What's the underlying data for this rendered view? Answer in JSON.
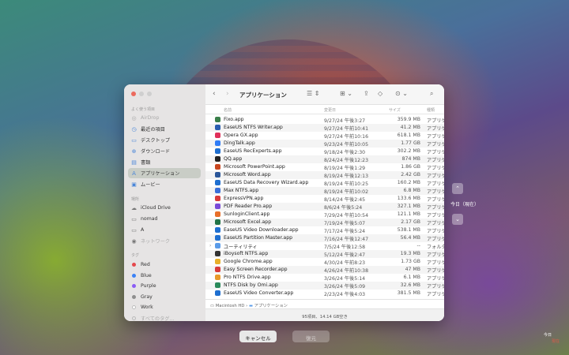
{
  "window": {
    "title": "アプリケーション"
  },
  "sidebar": {
    "favorites_label": "よく使う項目",
    "favorites": [
      {
        "icon": "airdrop-icon",
        "glyph": "◎",
        "label": "AirDrop",
        "dim": true
      },
      {
        "icon": "clock-icon",
        "glyph": "◷",
        "label": "最近の項目"
      },
      {
        "icon": "desktop-icon",
        "glyph": "▭",
        "label": "デスクトップ"
      },
      {
        "icon": "download-icon",
        "glyph": "⊕",
        "label": "ダウンロード"
      },
      {
        "icon": "document-icon",
        "glyph": "▤",
        "label": "書類"
      },
      {
        "icon": "applications-icon",
        "glyph": "A",
        "label": "アプリケーション",
        "selected": true
      },
      {
        "icon": "movie-icon",
        "glyph": "▣",
        "label": "ムービー"
      }
    ],
    "locations_label": "場所",
    "locations": [
      {
        "icon": "cloud-icon",
        "glyph": "☁",
        "label": "iCloud Drive"
      },
      {
        "icon": "drive-icon",
        "glyph": "▭",
        "label": "nomad"
      },
      {
        "icon": "drive-icon",
        "glyph": "▭",
        "label": "A"
      },
      {
        "icon": "network-icon",
        "glyph": "◉",
        "label": "ネットワーク",
        "dim": true
      }
    ],
    "tags_label": "タグ",
    "tags": [
      {
        "label": "Red",
        "color": "#e5484d"
      },
      {
        "label": "Blue",
        "color": "#3b82f6"
      },
      {
        "label": "Purple",
        "color": "#8b5cf6"
      },
      {
        "label": "Gray",
        "color": "#8e8e8e"
      },
      {
        "label": "Work",
        "color": "#ffffff"
      },
      {
        "label": "すべてのタグ…",
        "color": "",
        "dim": true
      }
    ]
  },
  "columns": {
    "name": "名前",
    "date": "変更日",
    "size": "サイズ",
    "kind": "種類"
  },
  "files": [
    {
      "name": "Fixo.app",
      "date": "9/27/24 午後3:27",
      "size": "359.9 MB",
      "kind": "アプリケーション",
      "color": "#3a7f4a"
    },
    {
      "name": "EaseUS NTFS Writer.app",
      "date": "9/27/24 午前10:41",
      "size": "41.2 MB",
      "kind": "アプリケーション",
      "color": "#2a5db0"
    },
    {
      "name": "Opera GX.app",
      "date": "9/27/24 午前10:16",
      "size": "618.1 MB",
      "kind": "アプリケーション",
      "color": "#e0305a"
    },
    {
      "name": "DingTalk.app",
      "date": "9/23/24 午前10:05",
      "size": "1.77 GB",
      "kind": "アプリケーション",
      "color": "#2f7cf6"
    },
    {
      "name": "EaseUS RecExperts.app",
      "date": "9/18/24 午後2:30",
      "size": "302.2 MB",
      "kind": "アプリケーション",
      "color": "#1f6fd0"
    },
    {
      "name": "QQ.app",
      "date": "8/24/24 午後12:23",
      "size": "874 MB",
      "kind": "アプリケーション",
      "color": "#222222"
    },
    {
      "name": "Microsoft PowerPoint.app",
      "date": "8/19/24 午後1:29",
      "size": "1.86 GB",
      "kind": "アプリケーション",
      "color": "#c8461f"
    },
    {
      "name": "Microsoft Word.app",
      "date": "8/19/24 午後12:13",
      "size": "2.42 GB",
      "kind": "アプリケーション",
      "color": "#2b579a"
    },
    {
      "name": "EaseUS Data Recovery Wizard.app",
      "date": "8/19/24 午前10:25",
      "size": "160.2 MB",
      "kind": "アプリケーション",
      "color": "#1f6fd0"
    },
    {
      "name": "Max NTFS.app",
      "date": "8/19/24 午前10:02",
      "size": "6.8 MB",
      "kind": "アプリケーション",
      "color": "#3a6fd8"
    },
    {
      "name": "ExpressVPN.app",
      "date": "8/14/24 午後2:45",
      "size": "133.6 MB",
      "kind": "アプリケーション",
      "color": "#d93a3a"
    },
    {
      "name": "PDF Reader Pro.app",
      "date": "8/6/24 午後5:24",
      "size": "327.1 MB",
      "kind": "アプリケーション",
      "color": "#7a4ad8"
    },
    {
      "name": "SunloginClient.app",
      "date": "7/29/24 午前10:54",
      "size": "121.1 MB",
      "kind": "アプリケーション",
      "color": "#e8702a"
    },
    {
      "name": "Microsoft Excel.app",
      "date": "7/19/24 午後5:07",
      "size": "2.17 GB",
      "kind": "アプリケーション",
      "color": "#217346"
    },
    {
      "name": "EaseUS Video Downloader.app",
      "date": "7/17/24 午後5:24",
      "size": "538.1 MB",
      "kind": "アプリケーション",
      "color": "#1f6fd0"
    },
    {
      "name": "EaseUS Partition Master.app",
      "date": "7/16/24 午後12:47",
      "size": "56.4 MB",
      "kind": "アプリケーション",
      "color": "#1f6fd0"
    },
    {
      "name": "ユーティリティ",
      "date": "7/5/24 午後12:58",
      "size": "--",
      "kind": "フォルダ",
      "color": "#5a9be8",
      "folder": true
    },
    {
      "name": "iBoysoft NTFS.app",
      "date": "5/12/24 午後2:47",
      "size": "19.3 MB",
      "kind": "アプリケーション",
      "color": "#333333"
    },
    {
      "name": "Google Chrome.app",
      "date": "4/30/24 午前8:23",
      "size": "1.73 GB",
      "kind": "アプリケーション",
      "color": "#e8b02a"
    },
    {
      "name": "Easy Screen Recorder.app",
      "date": "4/26/24 午前10:38",
      "size": "47 MB",
      "kind": "アプリケーション",
      "color": "#d83a3a"
    },
    {
      "name": "Pro NTFS Drive.app",
      "date": "3/26/24 午後5:14",
      "size": "6.1 MB",
      "kind": "アプリケーション",
      "color": "#e89a2a"
    },
    {
      "name": "NTFS Disk by Omi.app",
      "date": "3/26/24 午後5:09",
      "size": "32.6 MB",
      "kind": "アプリケーション",
      "color": "#2a8a5a"
    },
    {
      "name": "EaseUS Video Converter.app",
      "date": "2/23/24 午後4:03",
      "size": "381.5 MB",
      "kind": "アプリケーション",
      "color": "#1f6fd0"
    }
  ],
  "pathbar": {
    "root": "Macintosh HD",
    "sep": "›",
    "current": "アプリケーション"
  },
  "status": "95項目、14.14 GB空き",
  "buttons": {
    "cancel": "キャンセル",
    "restore": "復元"
  },
  "timemachine": {
    "now_label": "今日（現在）",
    "right_label": "今日",
    "right_sub": "現在"
  }
}
